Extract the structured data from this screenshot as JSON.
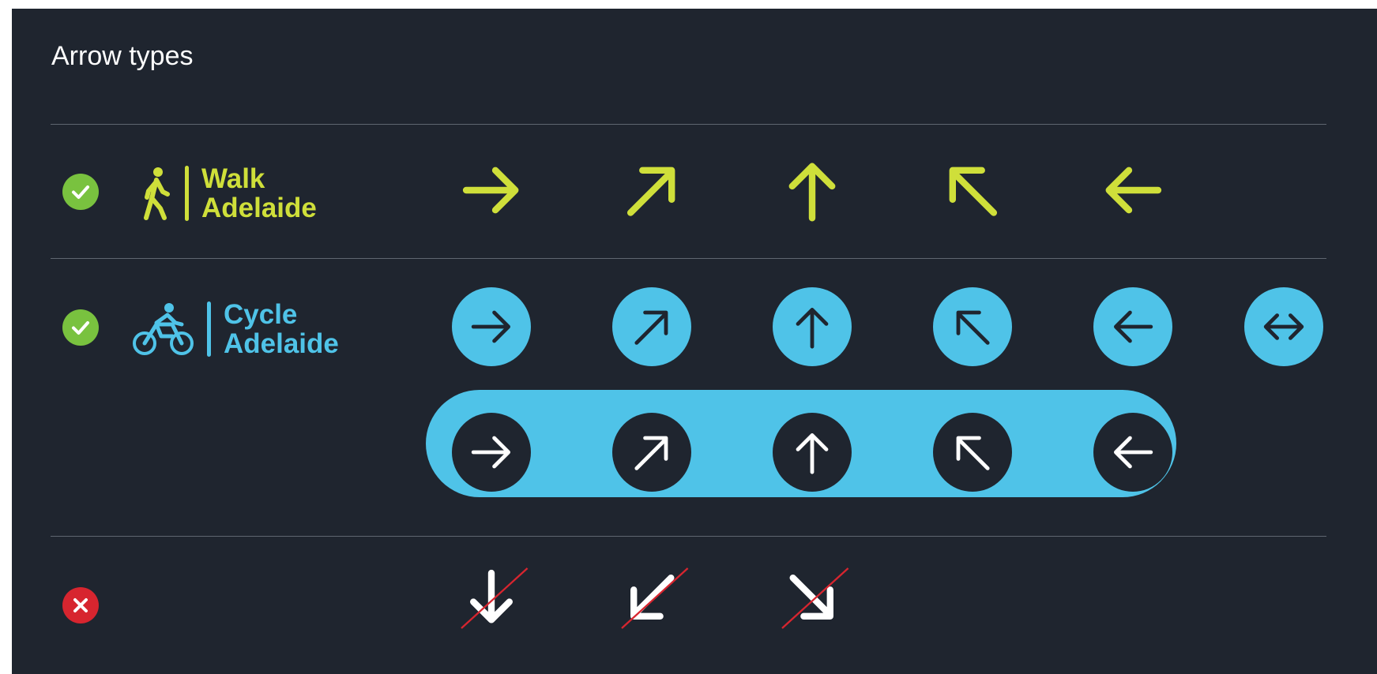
{
  "title": "Arrow types",
  "colors": {
    "background": "#1f252f",
    "walk": "#cfdf3a",
    "cycle": "#4fc3e8",
    "ok": "#79c23f",
    "bad": "#d7252f",
    "divider": "#5f6670"
  },
  "walk": {
    "status_icon": "check-icon",
    "brand_icon": "pedestrian-icon",
    "name_line1": "Walk",
    "name_line2": "Adelaide",
    "arrows": [
      "arrow-right",
      "arrow-up-right",
      "arrow-up",
      "arrow-up-left",
      "arrow-left"
    ]
  },
  "cycle": {
    "status_icon": "check-icon",
    "brand_icon": "bicycle-icon",
    "name_line1": "Cycle",
    "name_line2": "Adelaide",
    "arrows": [
      "arrow-right",
      "arrow-up-right",
      "arrow-up",
      "arrow-up-left",
      "arrow-left",
      "arrow-left-right"
    ],
    "pill_arrows": [
      "arrow-right",
      "arrow-up-right",
      "arrow-up",
      "arrow-up-left",
      "arrow-left"
    ]
  },
  "incorrect": {
    "status_icon": "cross-icon",
    "arrows": [
      "arrow-down",
      "arrow-down-left",
      "arrow-down-right"
    ]
  }
}
